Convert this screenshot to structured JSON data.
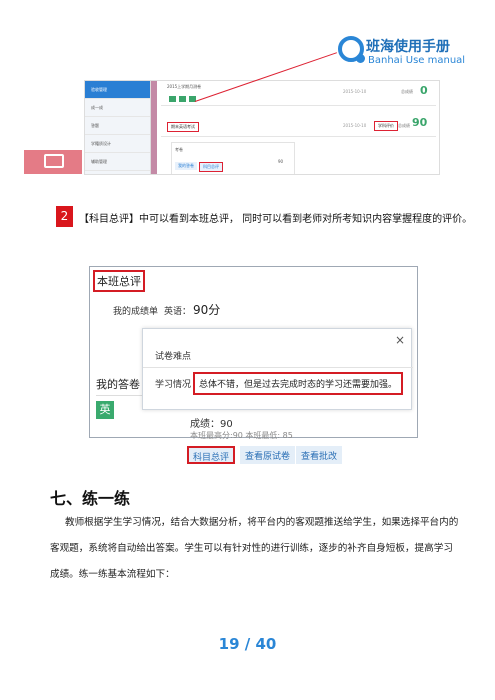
{
  "header": {
    "brand_cn": "班海使用手册",
    "brand_en": "Banhai Use manual",
    "brand_color": "#2a86d6"
  },
  "shot1": {
    "sidebar": [
      "验收管理",
      "成一成",
      "答题",
      "学籍质设计",
      "辅助管理"
    ],
    "title": "2015上学期月测卷",
    "rows": [
      {
        "date": "2015-10-10",
        "score_label": "总成绩",
        "score": "0"
      },
      {
        "date": "2015-10-10",
        "score_label": "总成绩",
        "score": "90"
      }
    ],
    "tag": "期末英语考试",
    "view_label": "学科评价",
    "card_label": "考卷",
    "card_score": "90",
    "mini_btn1": "我的答卷",
    "mini_btn2": "科目总评"
  },
  "note": {
    "num": "2",
    "text": "【科目总评】中可以看到本班总评， 同时可以看到老师对所考知识内容掌握程度的评价。"
  },
  "shot2": {
    "title": "本班总评",
    "score_label": "我的成绩单",
    "english_label": "英语：",
    "english_score": "90分",
    "my_answers": "我的答卷",
    "subject_tag": "英",
    "grade": "成绩：90",
    "stats": "本班最高分:90    本班最低: 85",
    "buttons": [
      "科目总评",
      "查看原试卷",
      "查看批改"
    ],
    "modal": {
      "title": "试卷难点",
      "close": "×",
      "label": "学习情况",
      "text": "总体不错，但是过去完成时态的学习还需要加强。"
    }
  },
  "section": {
    "title": "七、练一练",
    "p1": "教师根据学生学习情况，结合大数据分析，将平台内的客观题推送给学生，如果选择平台内的客观题，系统将自动给出答案。学生可以有针对性的进行训练，逐步的补齐自身短板，提高学习成绩。练一练基本流程如下："
  },
  "page": "19 / 40"
}
